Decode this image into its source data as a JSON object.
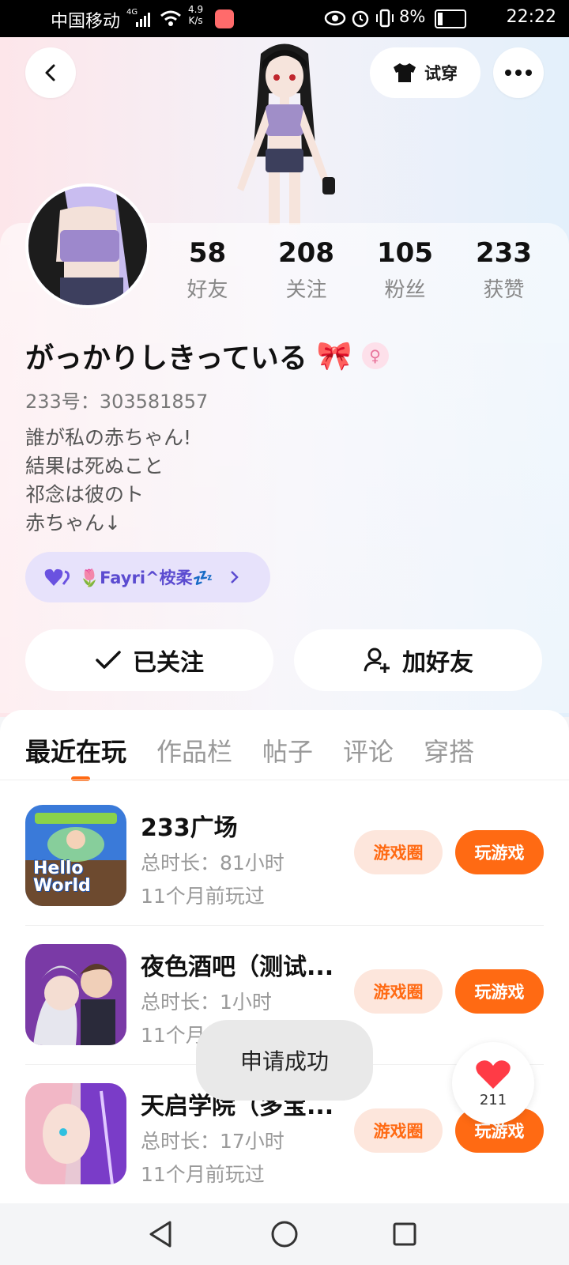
{
  "status_bar": {
    "carrier": "中国移动",
    "net_type": "4G",
    "net_speed_value": "4.9",
    "net_speed_unit": "K/s",
    "battery": "8%",
    "time": "22:22"
  },
  "header": {
    "try_on_label": "试穿"
  },
  "profile": {
    "stats": [
      {
        "value": "58",
        "label": "好友"
      },
      {
        "value": "208",
        "label": "关注"
      },
      {
        "value": "105",
        "label": "粉丝"
      },
      {
        "value": "233",
        "label": "获赞"
      }
    ],
    "nickname": "がっかりしきっている",
    "nickname_emoji": "🎀",
    "uid": "233号：303581857",
    "bio_lines": [
      "誰が私の赤ちゃん!",
      "結果は死ぬこと",
      "祁念は彼のト",
      "赤ちゃん↓"
    ],
    "tag_label": "🌷Fayri^桉柔💤"
  },
  "actions": {
    "follow_label": "已关注",
    "add_friend_label": "加好友"
  },
  "tabs": [
    "最近在玩",
    "作品栏",
    "帖子",
    "评论",
    "穿搭"
  ],
  "games": [
    {
      "title": "233广场",
      "duration": "总时长：81小时",
      "last_played": "11个月前玩过",
      "circle_label": "游戏圈",
      "play_label": "玩游戏",
      "icon_text": "Hello World"
    },
    {
      "title": "夜色酒吧（测试...",
      "duration": "总时长：1小时",
      "last_played": "11个月前玩过",
      "circle_label": "游戏圈",
      "play_label": "玩游戏"
    },
    {
      "title": "天启学院（多宝...",
      "duration": "总时长：17小时",
      "last_played": "11个月前玩过",
      "circle_label": "游戏圈",
      "play_label": "玩游戏"
    }
  ],
  "toast": "申请成功",
  "like_count": "211",
  "colors": {
    "accent": "#ff6a13",
    "accent_light": "#fde6dc",
    "tag_bg": "#e7e2fb",
    "tag_text": "#5b4bd0"
  }
}
